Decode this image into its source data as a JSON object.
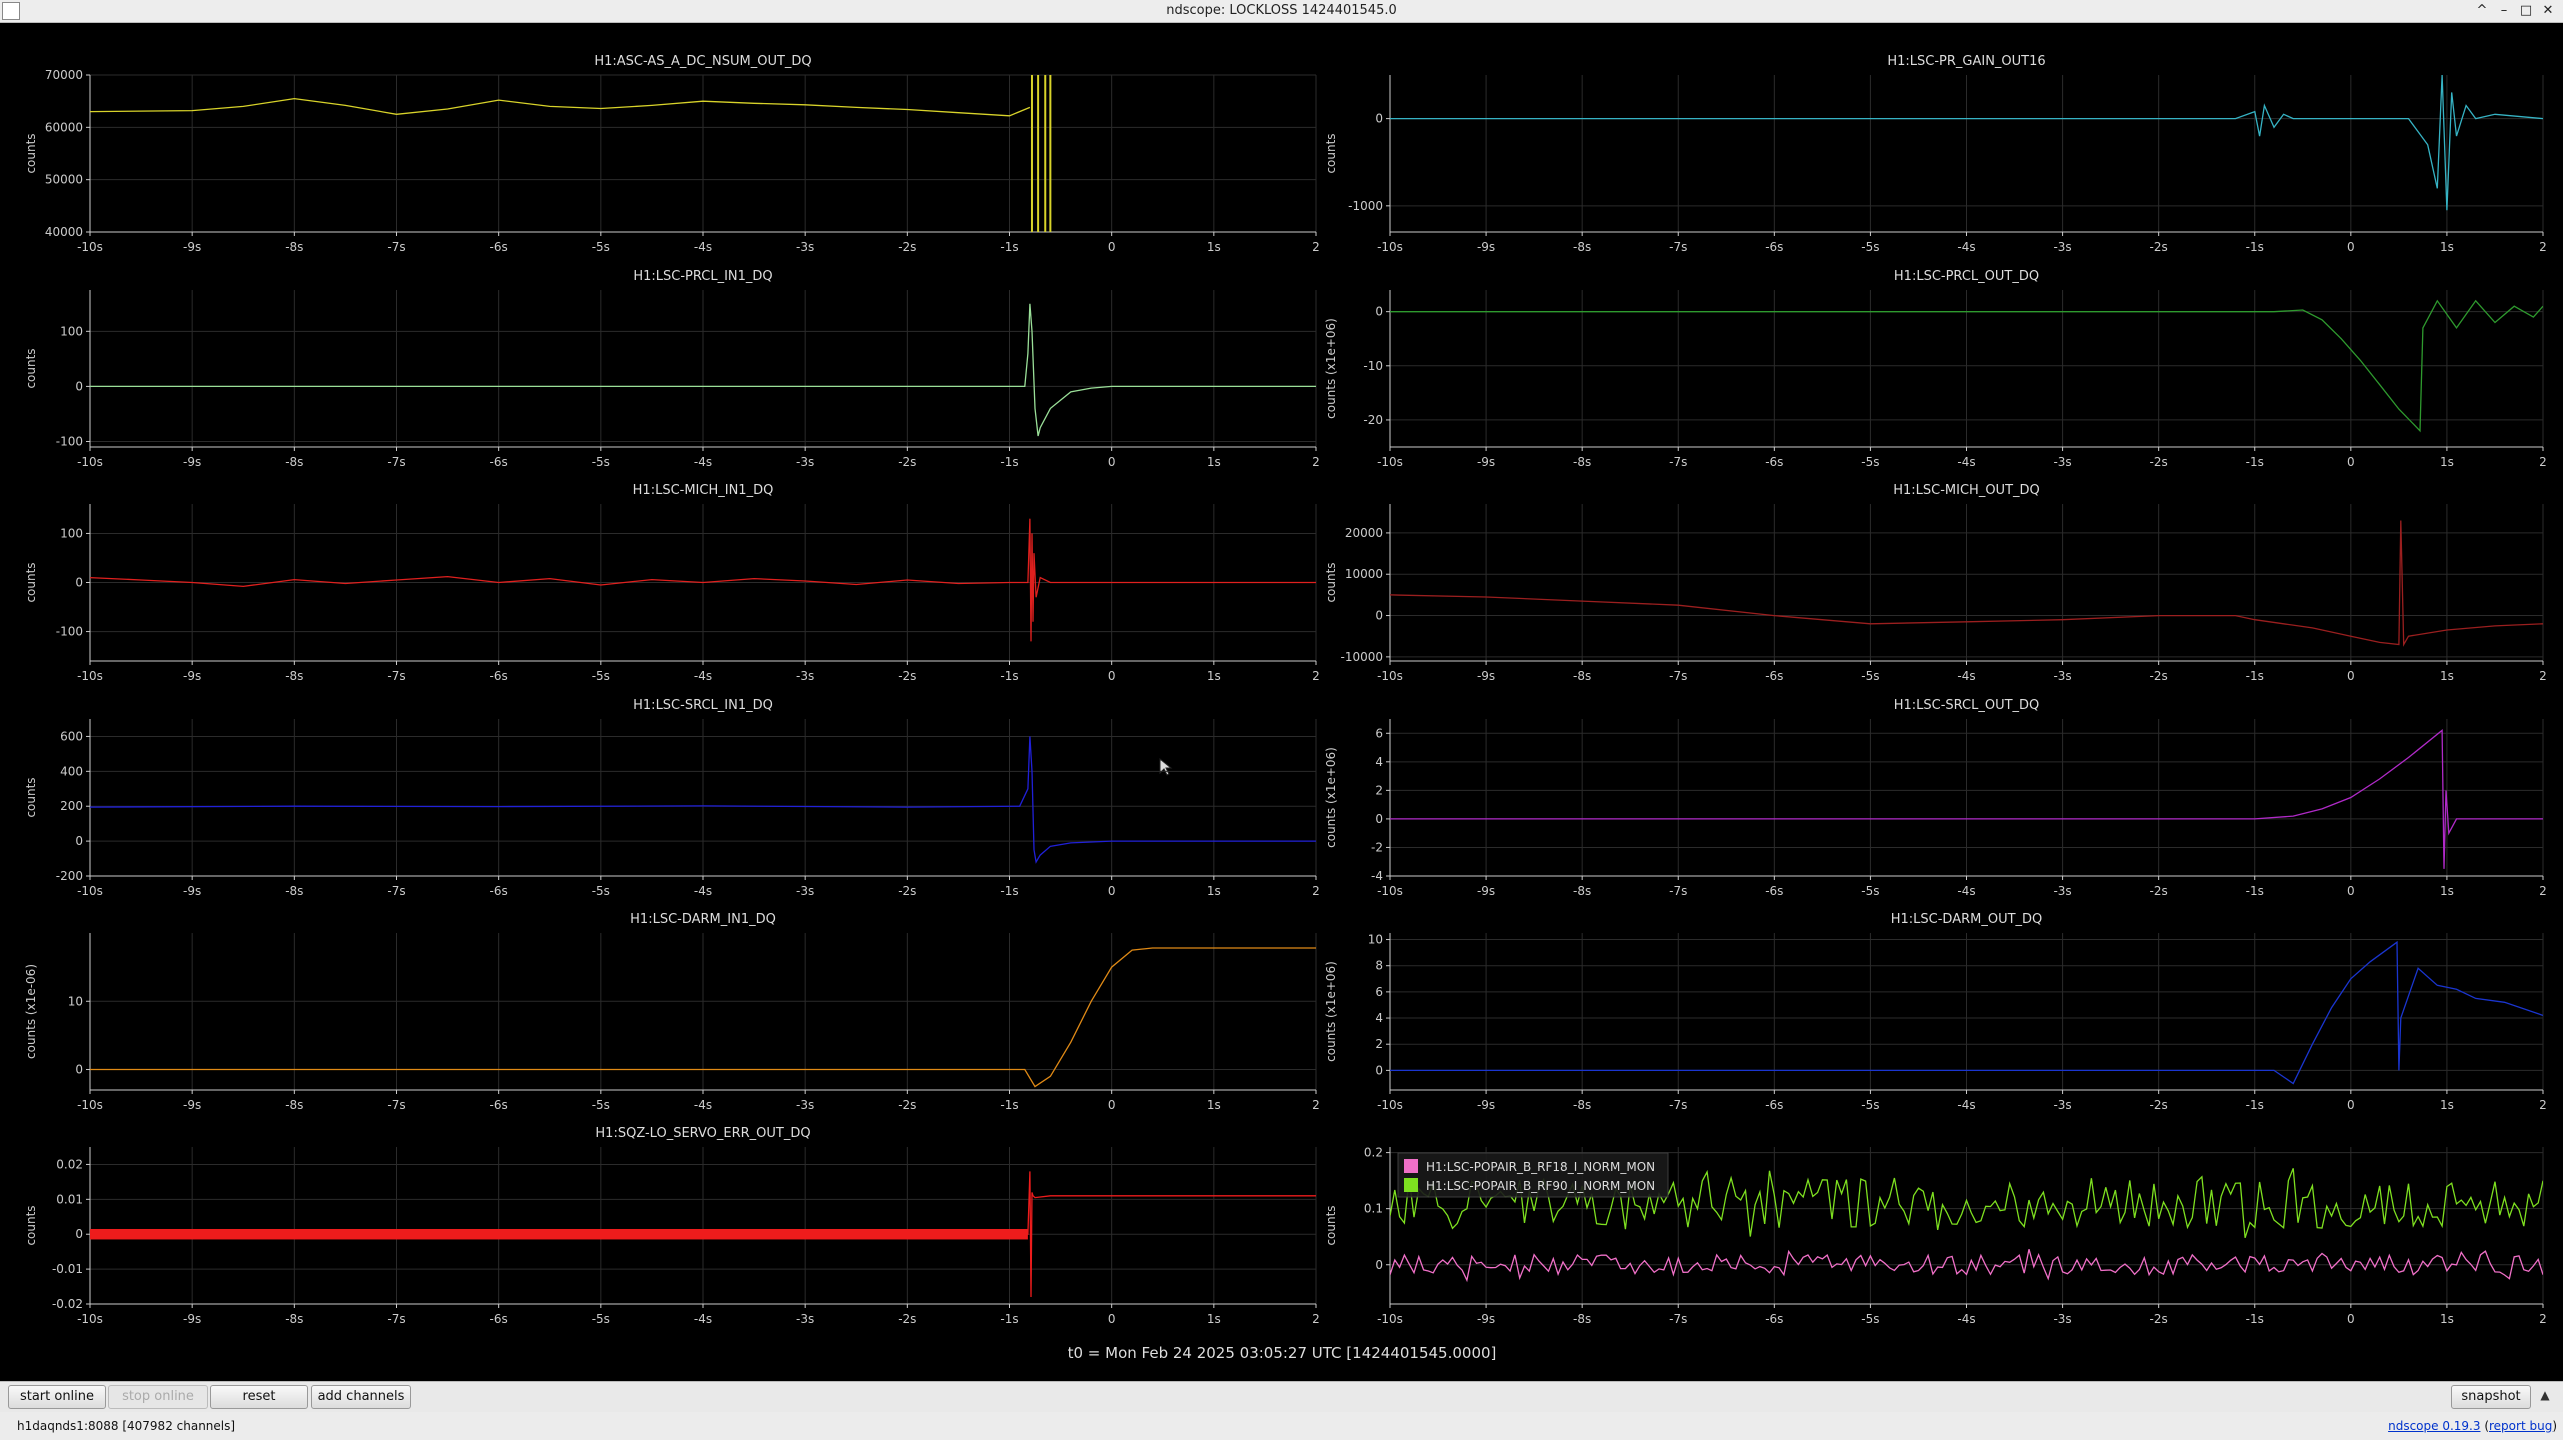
{
  "window": {
    "title": "ndscope: LOCKLOSS 1424401545.0",
    "minimize_icon": "chevron-up-icon",
    "controls": [
      "^",
      "–",
      "□",
      "✕"
    ]
  },
  "t0_label": "t0 = Mon Feb 24 2025 03:05:27 UTC [1424401545.0000]",
  "toolbar": {
    "start_online": "start online",
    "stop_online": "stop online",
    "reset": "reset",
    "add_channels": "add channels",
    "snapshot": "snapshot"
  },
  "status": {
    "server": "h1daqnds1:8088  [407982 channels]",
    "version_link": "ndscope 0.19.3",
    "report_link": "report bug"
  },
  "colors": {
    "background": "#000000",
    "grid": "#2b2b2b",
    "axis": "#cccccc"
  },
  "chart_data": [
    {
      "type": "line",
      "title": "H1:ASC-AS_A_DC_NSUM_OUT_DQ",
      "ylabel": "counts",
      "xticks": [
        "-10s",
        "-9s",
        "-8s",
        "-7s",
        "-6s",
        "-5s",
        "-4s",
        "-3s",
        "-2s",
        "-1s",
        "0",
        "1s",
        "2"
      ],
      "ylim": [
        40000,
        70000
      ],
      "yticks": [
        "40000",
        "50000",
        "60000",
        "70000"
      ],
      "series": [
        {
          "color": "#d8d32a",
          "x": [
            -10,
            -9,
            -8.5,
            -8,
            -7.5,
            -7,
            -6.5,
            -6,
            -5.5,
            -5,
            -4.5,
            -4,
            -3.5,
            -3,
            -2.5,
            -2,
            -1.5,
            -1,
            -0.8
          ],
          "y": [
            63000,
            63200,
            64000,
            65500,
            64200,
            62500,
            63500,
            65200,
            64000,
            63600,
            64200,
            65000,
            64600,
            64300,
            63800,
            63400,
            62800,
            62200,
            63800
          ]
        }
      ],
      "markers": [
        -0.78,
        -0.72,
        -0.65,
        -0.6
      ]
    },
    {
      "type": "line",
      "title": "H1:LSC-PR_GAIN_OUT16",
      "ylabel": "counts",
      "xticks": [
        "-10s",
        "-9s",
        "-8s",
        "-7s",
        "-6s",
        "-5s",
        "-4s",
        "-3s",
        "-2s",
        "-1s",
        "0",
        "1s",
        "2"
      ],
      "ylim": [
        -1300,
        500
      ],
      "yticks": [
        "-1000",
        "0"
      ],
      "series": [
        {
          "color": "#36b3c4",
          "x": [
            -10,
            -1.2,
            -1.0,
            -0.95,
            -0.9,
            -0.8,
            -0.7,
            -0.6,
            -0.5,
            0.6,
            0.8,
            0.9,
            0.95,
            1.0,
            1.05,
            1.1,
            1.2,
            1.3,
            1.5,
            2
          ],
          "y": [
            0,
            0,
            80,
            -200,
            150,
            -100,
            50,
            0,
            0,
            0,
            -300,
            -800,
            500,
            -1050,
            300,
            -200,
            150,
            0,
            50,
            0
          ]
        }
      ]
    },
    {
      "type": "line",
      "title": "H1:LSC-PRCL_IN1_DQ",
      "ylabel": "counts",
      "xticks": [
        "-10s",
        "-9s",
        "-8s",
        "-7s",
        "-6s",
        "-5s",
        "-4s",
        "-3s",
        "-2s",
        "-1s",
        "0",
        "1s",
        "2"
      ],
      "ylim": [
        -110,
        175
      ],
      "yticks": [
        "-100",
        "0",
        "100"
      ],
      "series": [
        {
          "color": "#9adf98",
          "x": [
            -10,
            -0.85,
            -0.82,
            -0.8,
            -0.78,
            -0.75,
            -0.72,
            -0.7,
            -0.6,
            -0.4,
            -0.2,
            0,
            2
          ],
          "y": [
            0,
            0,
            60,
            150,
            100,
            -40,
            -90,
            -75,
            -40,
            -10,
            -3,
            0,
            0
          ]
        }
      ]
    },
    {
      "type": "line",
      "title": "H1:LSC-PRCL_OUT_DQ",
      "ylabel": "counts (x1e+06)",
      "xticks": [
        "-10s",
        "-9s",
        "-8s",
        "-7s",
        "-6s",
        "-5s",
        "-4s",
        "-3s",
        "-2s",
        "-1s",
        "0",
        "1s",
        "2"
      ],
      "ylim": [
        -25,
        4
      ],
      "yticks": [
        "-20",
        "-10",
        "0"
      ],
      "series": [
        {
          "color": "#2e9a2e",
          "x": [
            -10,
            -0.8,
            -0.5,
            -0.3,
            -0.1,
            0.1,
            0.3,
            0.5,
            0.72,
            0.75,
            0.9,
            1.1,
            1.3,
            1.5,
            1.7,
            1.9,
            2
          ],
          "y": [
            0,
            0,
            0.3,
            -1.5,
            -5,
            -9,
            -13.5,
            -18,
            -22,
            -3,
            2,
            -3,
            2,
            -2,
            1,
            -1,
            1
          ]
        }
      ]
    },
    {
      "type": "line",
      "title": "H1:LSC-MICH_IN1_DQ",
      "ylabel": "counts",
      "xticks": [
        "-10s",
        "-9s",
        "-8s",
        "-7s",
        "-6s",
        "-5s",
        "-4s",
        "-3s",
        "-2s",
        "-1s",
        "0",
        "1s",
        "2"
      ],
      "ylim": [
        -160,
        160
      ],
      "yticks": [
        "-100",
        "0",
        "100"
      ],
      "series": [
        {
          "color": "#e0201e",
          "x": [
            -10,
            -9.5,
            -9,
            -8.5,
            -8,
            -7.5,
            -7,
            -6.5,
            -6,
            -5.5,
            -5,
            -4.5,
            -4,
            -3.5,
            -3,
            -2.5,
            -2,
            -1.5,
            -1,
            -0.82,
            -0.8,
            -0.79,
            -0.78,
            -0.77,
            -0.76,
            -0.74,
            -0.7,
            -0.6,
            0,
            2
          ],
          "y": [
            10,
            5,
            0,
            -8,
            6,
            -2,
            5,
            12,
            0,
            8,
            -5,
            6,
            0,
            8,
            3,
            -4,
            5,
            -2,
            0,
            0,
            130,
            -120,
            100,
            -80,
            60,
            -30,
            10,
            0,
            0,
            0
          ]
        }
      ]
    },
    {
      "type": "line",
      "title": "H1:LSC-MICH_OUT_DQ",
      "ylabel": "counts",
      "xticks": [
        "-10s",
        "-9s",
        "-8s",
        "-7s",
        "-6s",
        "-5s",
        "-4s",
        "-3s",
        "-2s",
        "-1s",
        "0",
        "1s",
        "2"
      ],
      "ylim": [
        -11000,
        27000
      ],
      "yticks": [
        "-10000",
        "0",
        "10000",
        "20000"
      ],
      "series": [
        {
          "color": "#9b1f1f",
          "x": [
            -10,
            -9,
            -8,
            -7,
            -6,
            -5,
            -4,
            -3,
            -2,
            -1.2,
            -1.0,
            -0.7,
            -0.4,
            0,
            0.3,
            0.5,
            0.52,
            0.55,
            0.6,
            1.0,
            1.5,
            2
          ],
          "y": [
            5000,
            4500,
            3500,
            2500,
            0,
            -2000,
            -1500,
            -1000,
            0,
            0,
            -1000,
            -2000,
            -3000,
            -5000,
            -6500,
            -7000,
            23000,
            -7000,
            -5000,
            -3500,
            -2500,
            -2000
          ]
        }
      ]
    },
    {
      "type": "line",
      "title": "H1:LSC-SRCL_IN1_DQ",
      "ylabel": "counts",
      "xticks": [
        "-10s",
        "-9s",
        "-8s",
        "-7s",
        "-6s",
        "-5s",
        "-4s",
        "-3s",
        "-2s",
        "-1s",
        "0",
        "1s",
        "2"
      ],
      "ylim": [
        -200,
        700
      ],
      "yticks": [
        "-200",
        "0",
        "200",
        "400",
        "600"
      ],
      "series": [
        {
          "color": "#2020d8",
          "x": [
            -10,
            -8,
            -6,
            -4,
            -2,
            -0.9,
            -0.82,
            -0.8,
            -0.78,
            -0.76,
            -0.74,
            -0.72,
            -0.7,
            -0.6,
            -0.4,
            0,
            2
          ],
          "y": [
            195,
            200,
            198,
            202,
            195,
            200,
            300,
            600,
            400,
            -50,
            -120,
            -100,
            -80,
            -30,
            -10,
            0,
            0
          ]
        }
      ]
    },
    {
      "type": "line",
      "title": "H1:LSC-SRCL_OUT_DQ",
      "ylabel": "counts (x1e+06)",
      "xticks": [
        "-10s",
        "-9s",
        "-8s",
        "-7s",
        "-6s",
        "-5s",
        "-4s",
        "-3s",
        "-2s",
        "-1s",
        "0",
        "1s",
        "2"
      ],
      "ylim": [
        -4,
        7
      ],
      "yticks": [
        "-4",
        "-2",
        "0",
        "2",
        "4",
        "6"
      ],
      "series": [
        {
          "color": "#b02ac8",
          "x": [
            -10,
            -1.0,
            -0.6,
            -0.3,
            0,
            0.3,
            0.6,
            0.95,
            0.97,
            0.99,
            1.02,
            1.1,
            2
          ],
          "y": [
            0,
            0,
            0.2,
            0.7,
            1.5,
            2.8,
            4.3,
            6.2,
            -3.5,
            2,
            -1,
            0,
            0
          ]
        }
      ]
    },
    {
      "type": "line",
      "title": "H1:LSC-DARM_IN1_DQ",
      "ylabel": "counts (x1e-06)",
      "xticks": [
        "-10s",
        "-9s",
        "-8s",
        "-7s",
        "-6s",
        "-5s",
        "-4s",
        "-3s",
        "-2s",
        "-1s",
        "0",
        "1s",
        "2"
      ],
      "ylim": [
        -3,
        20
      ],
      "yticks": [
        "0",
        "10"
      ],
      "series": [
        {
          "color": "#e08a16",
          "x": [
            -10,
            -0.85,
            -0.75,
            -0.6,
            -0.4,
            -0.2,
            0,
            0.2,
            0.4,
            0.7,
            2
          ],
          "y": [
            0,
            0,
            -2.5,
            -1,
            4,
            10,
            15,
            17.5,
            17.8,
            17.8,
            17.8
          ]
        }
      ]
    },
    {
      "type": "line",
      "title": "H1:LSC-DARM_OUT_DQ",
      "ylabel": "counts (x1e+06)",
      "xticks": [
        "-10s",
        "-9s",
        "-8s",
        "-7s",
        "-6s",
        "-5s",
        "-4s",
        "-3s",
        "-2s",
        "-1s",
        "0",
        "1s",
        "2"
      ],
      "ylim": [
        -1.5,
        10.5
      ],
      "yticks": [
        "0",
        "2",
        "4",
        "6",
        "8",
        "10"
      ],
      "series": [
        {
          "color": "#1a35d0",
          "x": [
            -10,
            -0.8,
            -0.6,
            -0.4,
            -0.2,
            0,
            0.2,
            0.48,
            0.5,
            0.52,
            0.7,
            0.9,
            1.1,
            1.3,
            1.6,
            2
          ],
          "y": [
            0,
            0,
            -1,
            2,
            4.8,
            7,
            8.3,
            9.8,
            0,
            4,
            7.8,
            6.5,
            6.2,
            5.5,
            5.2,
            4.2
          ]
        }
      ]
    },
    {
      "type": "line",
      "title": "H1:SQZ-LO_SERVO_ERR_OUT_DQ",
      "ylabel": "counts",
      "xticks": [
        "-10s",
        "-9s",
        "-8s",
        "-7s",
        "-6s",
        "-5s",
        "-4s",
        "-3s",
        "-2s",
        "-1s",
        "0",
        "1s",
        "2"
      ],
      "ylim": [
        -0.02,
        0.025
      ],
      "yticks": [
        "-0.02",
        "-0.01",
        "0",
        "0.01",
        "0.02"
      ],
      "series": [
        {
          "color": "#ee1c1c",
          "x": [
            -10,
            -0.82,
            -0.8,
            -0.79,
            -0.78,
            -0.77,
            -0.75,
            -0.6,
            -0.4,
            -0.3,
            0,
            2
          ],
          "y": [
            0,
            0,
            0.018,
            -0.018,
            0.012,
            0.011,
            0.0105,
            0.011,
            0.011,
            0.011,
            0.011,
            0.011
          ]
        }
      ],
      "noise_band": {
        "from": -10,
        "to": -0.82,
        "halfwidth": 0.0015
      }
    },
    {
      "type": "line",
      "title": "",
      "ylabel": "counts",
      "xticks": [
        "-10s",
        "-9s",
        "-8s",
        "-7s",
        "-6s",
        "-5s",
        "-4s",
        "-3s",
        "-2s",
        "-1s",
        "0",
        "1s",
        "2"
      ],
      "ylim": [
        -0.07,
        0.21
      ],
      "yticks": [
        "0",
        "0.1",
        "0.2"
      ],
      "legend": [
        "H1:LSC-POPAIR_B_RF18_I_NORM_MON",
        "H1:LSC-POPAIR_B_RF90_I_NORM_MON"
      ],
      "series": [
        {
          "name": "H1:LSC-POPAIR_B_RF18_I_NORM_MON",
          "color": "#f070c8",
          "mean": 0.0,
          "amp": 0.018
        },
        {
          "name": "H1:LSC-POPAIR_B_RF90_I_NORM_MON",
          "color": "#7ee020",
          "mean": 0.11,
          "amp": 0.045
        }
      ]
    }
  ]
}
